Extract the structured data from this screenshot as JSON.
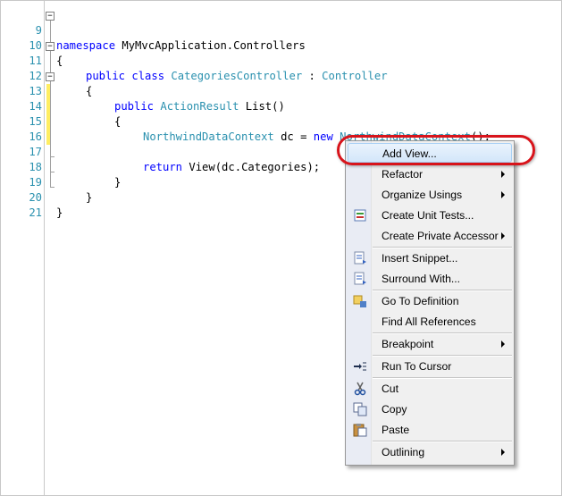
{
  "editor": {
    "lines": [
      {
        "num": "9",
        "seg": [
          "namespace",
          " MyMvcApplication.Controllers",
          "",
          "",
          "",
          ""
        ]
      },
      {
        "num": "10",
        "seg": [
          "",
          "{",
          "",
          "",
          "",
          ""
        ]
      },
      {
        "num": "11",
        "seg": [
          "public class",
          " ",
          "CategoriesController",
          " : ",
          "Controller",
          ""
        ]
      },
      {
        "num": "12",
        "seg": [
          "",
          "{",
          "",
          "",
          "",
          ""
        ]
      },
      {
        "num": "13",
        "seg": [
          "public",
          " ",
          "ActionResult",
          " List()",
          "",
          ""
        ]
      },
      {
        "num": "14",
        "seg": [
          "",
          "{",
          "",
          "",
          "",
          ""
        ]
      },
      {
        "num": "15",
        "seg": [
          "",
          "",
          "NorthwindDataContext",
          " dc = ",
          "new",
          " "
        ]
      },
      {
        "num": "16",
        "seg": [
          "",
          "",
          "",
          "",
          "",
          ""
        ]
      },
      {
        "num": "17",
        "seg": [
          "return",
          " View(dc.Categories);",
          "",
          "",
          "",
          ""
        ]
      },
      {
        "num": "18",
        "seg": [
          "",
          "}",
          "",
          "",
          "",
          ""
        ]
      },
      {
        "num": "19",
        "seg": [
          "",
          "}",
          "",
          "",
          "",
          ""
        ]
      },
      {
        "num": "20",
        "seg": [
          "",
          "}",
          "",
          "",
          "",
          ""
        ]
      },
      {
        "num": "21",
        "seg": [
          "",
          "",
          "",
          "",
          "",
          ""
        ]
      }
    ],
    "line15_tail": "NorthwindDataContext",
    "line15_end": "();"
  },
  "context_menu": {
    "items": [
      {
        "label": "Add View...",
        "icon": "",
        "submenu": false
      },
      {
        "label": "Refactor",
        "icon": "",
        "submenu": true
      },
      {
        "label": "Organize Usings",
        "icon": "",
        "submenu": true
      },
      {
        "label": "Create Unit Tests...",
        "icon": "unit-test-icon",
        "submenu": false
      },
      {
        "label": "Create Private Accessor",
        "icon": "",
        "submenu": true
      },
      {
        "label": "Insert Snippet...",
        "icon": "insert-snippet-icon",
        "submenu": false
      },
      {
        "label": "Surround With...",
        "icon": "surround-with-icon",
        "submenu": false
      },
      {
        "label": "Go To Definition",
        "icon": "go-to-definition-icon",
        "submenu": false
      },
      {
        "label": "Find All References",
        "icon": "",
        "submenu": false
      },
      {
        "label": "Breakpoint",
        "icon": "",
        "submenu": true
      },
      {
        "label": "Run To Cursor",
        "icon": "run-to-cursor-icon",
        "submenu": false
      },
      {
        "label": "Cut",
        "icon": "cut-icon",
        "submenu": false
      },
      {
        "label": "Copy",
        "icon": "copy-icon",
        "submenu": false
      },
      {
        "label": "Paste",
        "icon": "paste-icon",
        "submenu": false
      },
      {
        "label": "Outlining",
        "icon": "",
        "submenu": true
      }
    ]
  },
  "colors": {
    "keyword": "#0000ff",
    "type": "#2b91af",
    "line_number": "#2b91af",
    "annotation_ring": "#d8141b"
  }
}
